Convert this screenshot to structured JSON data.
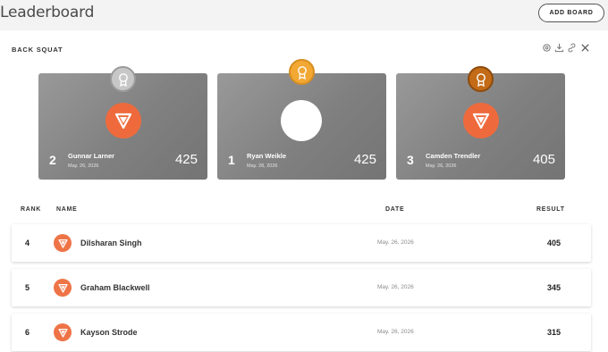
{
  "header": {
    "title": "Leaderboard",
    "add_board_label": "ADD BOARD"
  },
  "board": {
    "title": "BACK SQUAT",
    "tools": [
      "settings-icon",
      "download-icon",
      "link-icon",
      "close-icon"
    ]
  },
  "podium": [
    {
      "rank": "2",
      "name": "Gunnar Larner",
      "date": "May. 26, 2026",
      "score": "425",
      "medal": "silver",
      "medal_color": "#c7c7c7",
      "avatar": "logo"
    },
    {
      "rank": "1",
      "name": "Ryan Weikle",
      "date": "May. 28, 2026",
      "score": "425",
      "medal": "gold",
      "medal_color": "#f2a833",
      "avatar": "blank"
    },
    {
      "rank": "3",
      "name": "Camden Trendler",
      "date": "May. 26, 2026",
      "score": "405",
      "medal": "bronze",
      "medal_color": "#c36b16",
      "avatar": "logo"
    }
  ],
  "columns": {
    "rank": "RANK",
    "name": "NAME",
    "date": "DATE",
    "result": "RESULT"
  },
  "rows": [
    {
      "rank": "4",
      "name": "Dilsharan Singh",
      "date": "May. 26, 2026",
      "result": "405"
    },
    {
      "rank": "5",
      "name": "Graham Blackwell",
      "date": "May. 26, 2026",
      "result": "345"
    },
    {
      "rank": "6",
      "name": "Kayson Strode",
      "date": "May. 26, 2026",
      "result": "315"
    }
  ],
  "colors": {
    "accent": "#ee6a3c",
    "card_gray": "#888888"
  }
}
